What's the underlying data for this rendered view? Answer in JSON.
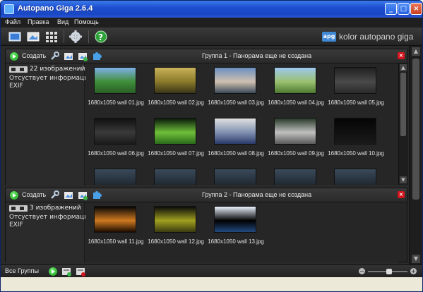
{
  "window": {
    "title": "Autopano Giga 2.6.4"
  },
  "menu": [
    "Файл",
    "Правка",
    "Вид",
    "Помощь"
  ],
  "toolbar": {
    "buttons": [
      "open-images-icon",
      "import-panorama-icon",
      "detect-icon",
      "settings-gear-icon",
      "help-icon"
    ],
    "brand_badge": "apg",
    "brand_text": "kolor autopano giga"
  },
  "groups": [
    {
      "create_label": "Создать",
      "title": "Группа 1 - Панорама еще не создана",
      "count_text": "22 изображений",
      "info_line1": "Отсуствует информация",
      "info_line2": "EXIF",
      "images": [
        "1680x1050 wall 01.jpg",
        "1680x1050 wall 02.jpg",
        "1680x1050 wall 03.jpg",
        "1680x1050 wall 04.jpg",
        "1680x1050 wall 05.jpg",
        "1680x1050 wall 06.jpg",
        "1680x1050 wall 07.jpg",
        "1680x1050 wall 08.jpg",
        "1680x1050 wall 09.jpg",
        "1680x1050 wall 10.jpg"
      ]
    },
    {
      "create_label": "Создать",
      "title": "Группа 2 - Панорама еще не создана",
      "count_text": "3 изображений",
      "info_line1": "Отсуствует информация",
      "info_line2": "EXIF",
      "images": [
        "1680x1050 wall 11.jpg",
        "1680x1050 wall 12.jpg",
        "1680x1050 wall 13.jpg"
      ]
    }
  ],
  "bottom": {
    "label": "Все Группы"
  },
  "zoom": {
    "level": 0.55
  }
}
